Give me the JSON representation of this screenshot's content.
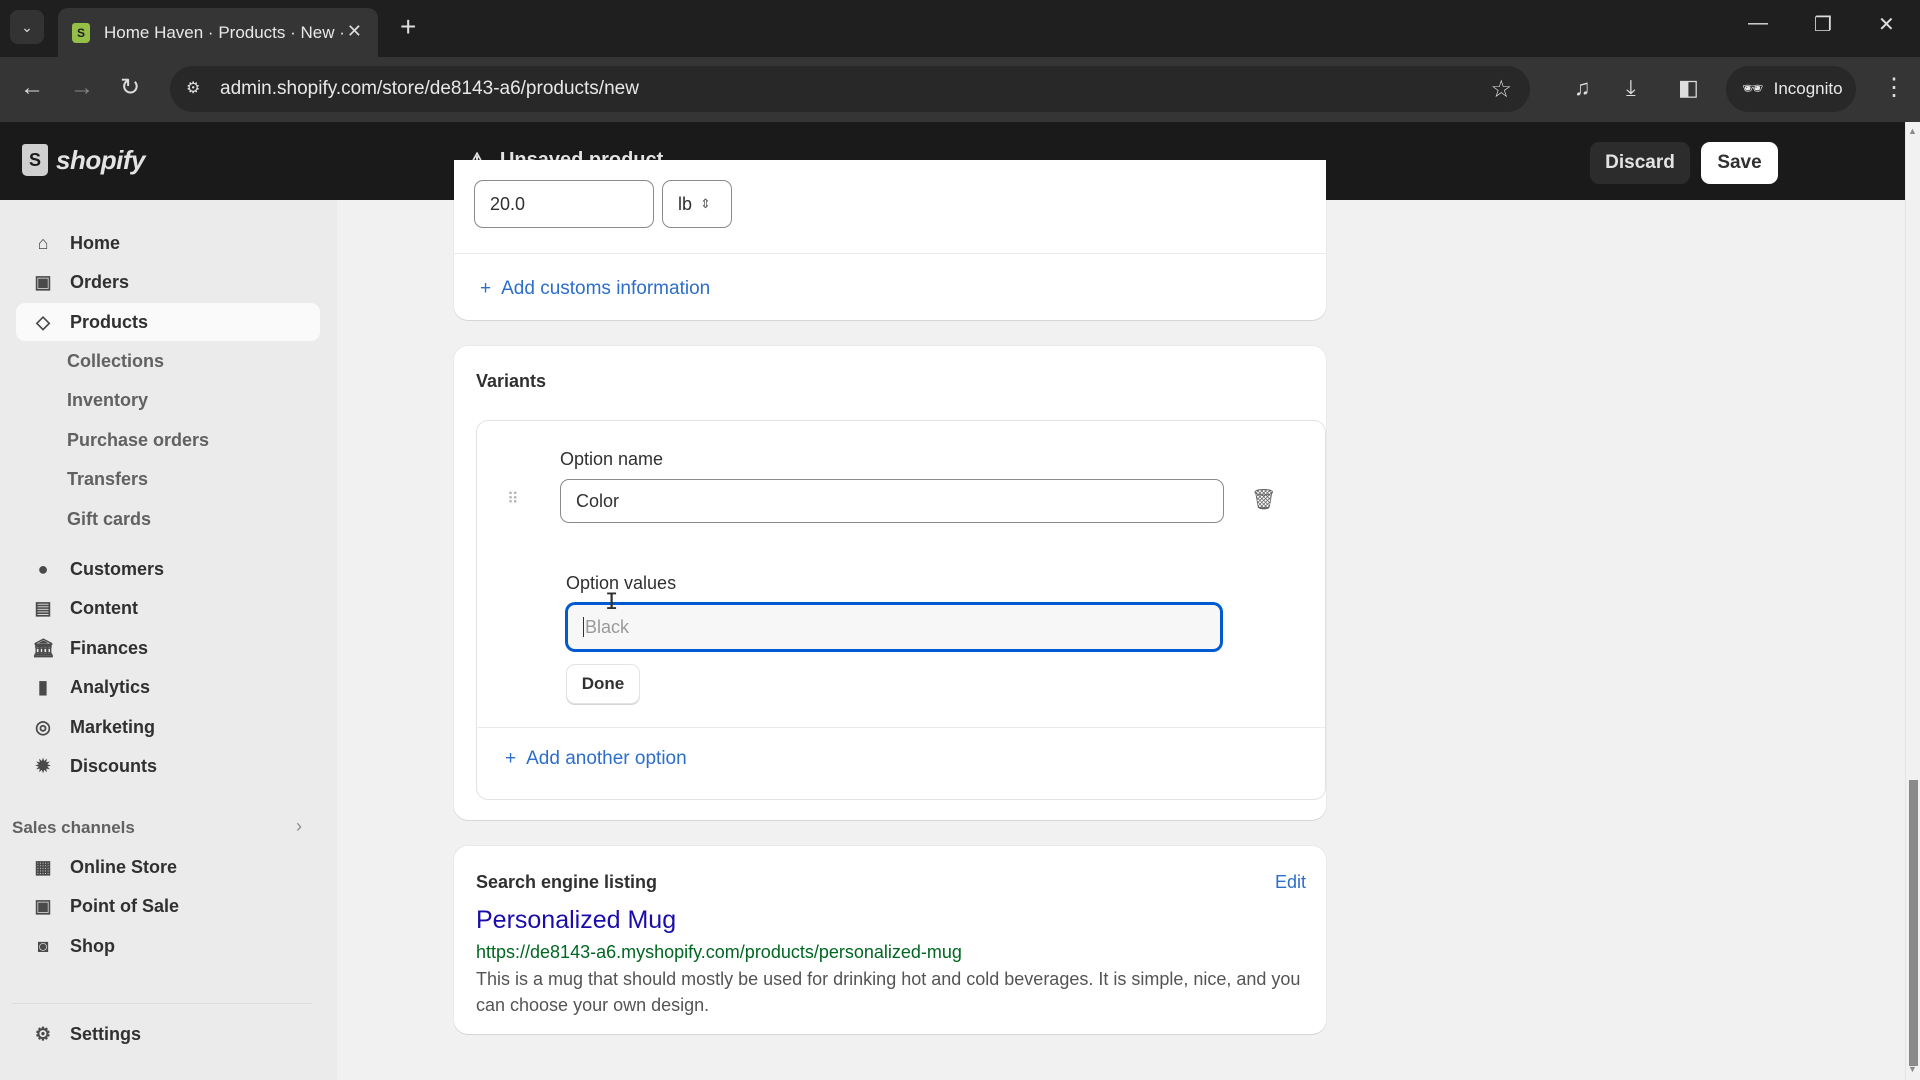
{
  "browser": {
    "tab_title": "Home Haven · Products · New ·",
    "url": "admin.shopify.com/store/de8143-a6/products/new",
    "incognito_label": "Incognito"
  },
  "header": {
    "logo_text": "shopify",
    "status": "Unsaved product",
    "discard_label": "Discard",
    "save_label": "Save"
  },
  "sidebar": {
    "items": [
      {
        "label": "Home",
        "icon": "home-icon"
      },
      {
        "label": "Orders",
        "icon": "orders-icon"
      },
      {
        "label": "Products",
        "icon": "tag-icon",
        "active": true
      },
      {
        "label": "Customers",
        "icon": "person-icon"
      },
      {
        "label": "Content",
        "icon": "content-icon"
      },
      {
        "label": "Finances",
        "icon": "bank-icon"
      },
      {
        "label": "Analytics",
        "icon": "bar-chart-icon"
      },
      {
        "label": "Marketing",
        "icon": "target-icon"
      },
      {
        "label": "Discounts",
        "icon": "discount-icon"
      }
    ],
    "product_subitems": [
      "Collections",
      "Inventory",
      "Purchase orders",
      "Transfers",
      "Gift cards"
    ],
    "sales_channels_label": "Sales channels",
    "channels": [
      {
        "label": "Online Store",
        "icon": "store-icon"
      },
      {
        "label": "Point of Sale",
        "icon": "pos-icon"
      },
      {
        "label": "Shop",
        "icon": "shop-icon"
      }
    ],
    "settings_label": "Settings"
  },
  "shipping": {
    "weight_value": "20.0",
    "weight_unit": "lb",
    "customs_link": "Add customs information"
  },
  "variants": {
    "title": "Variants",
    "option_name_label": "Option name",
    "option_name_value": "Color",
    "option_values_label": "Option values",
    "option_values_placeholder": "Black",
    "done_label": "Done",
    "add_option_link": "Add another option"
  },
  "seo": {
    "title": "Search engine listing",
    "edit_label": "Edit",
    "page_title": "Personalized Mug",
    "url": "https://de8143-a6.myshopify.com/products/personalized-mug",
    "description": "This is a mug that should mostly be used for drinking hot and cold beverages. It is simple, nice, and you can choose your own design."
  },
  "colors": {
    "accent": "#005bd3",
    "link": "#2c6ecb",
    "seo_title": "#1a0dab",
    "seo_url": "#006621",
    "header_bg": "#1a1a1a"
  }
}
